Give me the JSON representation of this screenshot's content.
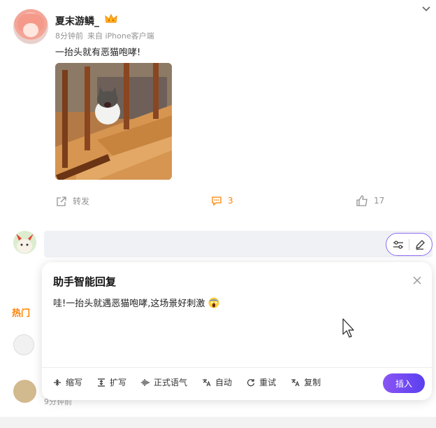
{
  "post": {
    "username": "夏末游鳞_",
    "time": "8分钟前",
    "source": "来自 iPhone客户端",
    "text": "一抬头就有恶猫咆哮!"
  },
  "actions": {
    "repost_label": "转发",
    "comment_count": "3",
    "like_count": "17"
  },
  "feed": {
    "hot_label": "热门",
    "time": "9分钟前"
  },
  "ai_reply": {
    "title": "助手智能回复",
    "reply_text": "哇!一抬头就遇恶猫咆哮,这场景好刺激",
    "tools": [
      "缩写",
      "扩写",
      "正式语气",
      "自动",
      "重试",
      "复制"
    ],
    "insert_label": "插入"
  },
  "colors": {
    "accent_orange": "#ff8200",
    "accent_purple": "#6a48f2",
    "muted_text": "#939393"
  },
  "icons": [
    "crown-icon",
    "chevron-down-icon",
    "repost-icon",
    "comment-icon",
    "like-icon",
    "adjust-icon",
    "pen-icon",
    "close-icon",
    "shrink-icon",
    "expand-icon",
    "voice-icon",
    "translate-icon",
    "retry-icon",
    "copy-icon",
    "cursor-icon"
  ]
}
